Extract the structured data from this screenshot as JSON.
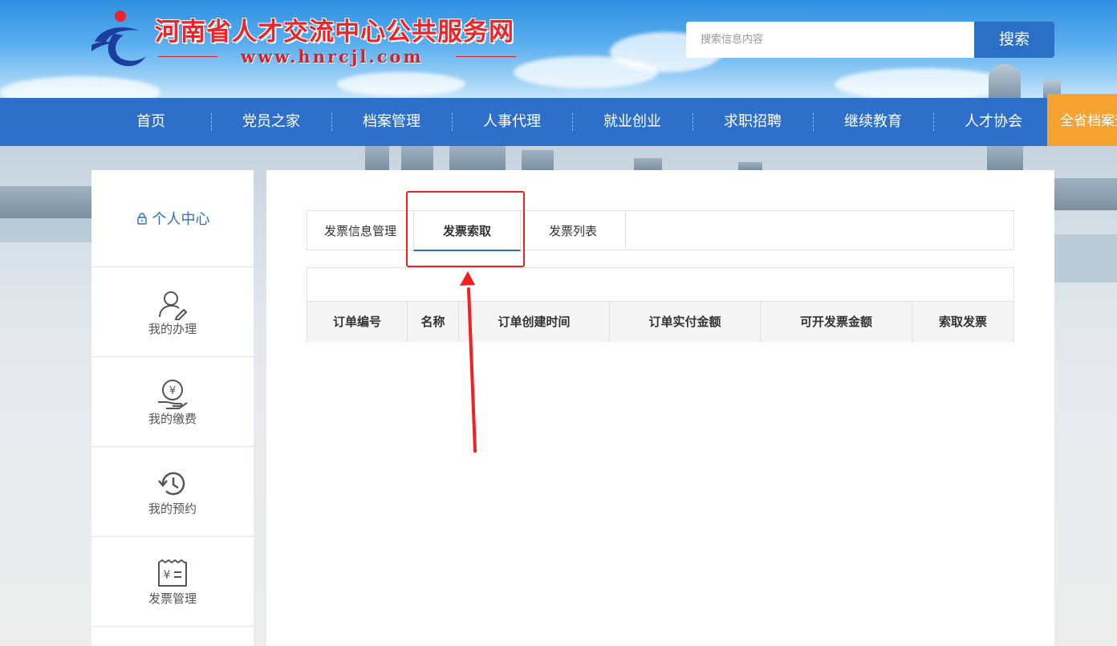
{
  "header": {
    "site_title": "河南省人才交流中心公共服务网",
    "site_url": "www.hnrcjl.com",
    "search_placeholder": "搜索信息内容",
    "search_button": "搜索"
  },
  "nav": {
    "items": [
      {
        "label": "首页"
      },
      {
        "label": "党员之家"
      },
      {
        "label": "档案管理"
      },
      {
        "label": "人事代理"
      },
      {
        "label": "就业创业"
      },
      {
        "label": "求职招聘"
      },
      {
        "label": "继续教育"
      },
      {
        "label": "人才协会"
      }
    ],
    "highlight_item": "全省档案查"
  },
  "sidebar": {
    "title": "个人中心",
    "items": [
      {
        "label": "我的办理",
        "icon": "user-edit-icon"
      },
      {
        "label": "我的缴费",
        "icon": "yuan-hand-icon"
      },
      {
        "label": "我的预约",
        "icon": "history-clock-icon"
      },
      {
        "label": "发票管理",
        "icon": "invoice-icon"
      }
    ]
  },
  "tabs": {
    "items": [
      {
        "label": "发票信息管理"
      },
      {
        "label": "发票索取"
      },
      {
        "label": "发票列表"
      }
    ],
    "active": "发票索取"
  },
  "table": {
    "columns": [
      "订单编号",
      "名称",
      "订单创建时间",
      "订单实付金额",
      "可开发票金额",
      "索取发票"
    ]
  },
  "colors": {
    "nav_bg": "#2e70c9",
    "accent_blue": "#2e6fc3",
    "orange": "#f5a230",
    "annotation_red": "#f2201f",
    "title_red": "#e8262b"
  }
}
